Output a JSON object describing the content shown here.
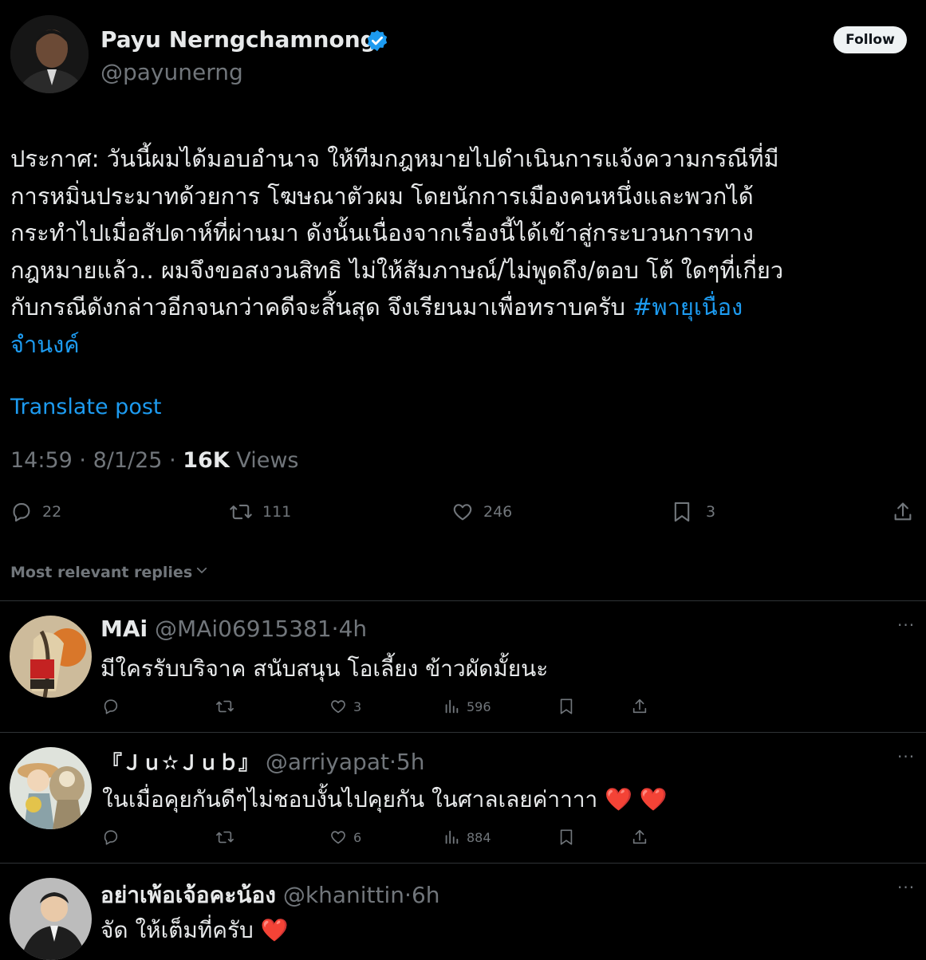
{
  "post": {
    "author_name": "Payu Nerngchamnong",
    "author_handle": "@payunerng",
    "follow_label": "Follow",
    "text_lines": [
      "ประกาศ: วันนี้ผมได้มอบอำนาจ ให้ทีมกฎหมายไปดำเนินการแจ้งความกรณีที่มี",
      "การหมิ่นประมาทด้วยการ โฆษณาตัวผม โดยนักการเมืองคนหนึ่งและพวกได้",
      "กระทำไปเมื่อสัปดาห์ที่ผ่านมา ดังนั้นเนื่องจากเรื่องนี้ได้เข้าสู่กระบวนการทาง",
      "กฎหมายแล้ว.. ผมจึงขอสงวนสิทธิ ไม่ให้สัมภาษณ์/ไม่พูดถึง/ตอบ โต้ ใดๆที่เกี่ยว",
      "กับกรณีดังกล่าวอีกจนกว่าคดีจะสิ้นสุด จึงเรียนมาเพื่อทราบครับ "
    ],
    "hashtag_part1": "#พายุเนื่อง",
    "hashtag_part2": "จำนงค์",
    "translate_label": "Translate post",
    "time": "14:59",
    "date": "8/1/25",
    "views_count": "16K",
    "views_label": "Views",
    "replies": "22",
    "reposts": "111",
    "likes": "246",
    "bookmarks": "3"
  },
  "replies_header": "Most relevant replies",
  "replies": [
    {
      "name": "MAi",
      "handle": "@MAi06915381",
      "time": "4h",
      "text": "มีใครรับบริจาค สนับสนุน โอเลี้ยง ข้าวผัดมั้ยนะ",
      "likes": "3",
      "views": "596"
    },
    {
      "name": "『Ｊｕ✫Ｊｕｂ』",
      "handle": "@arriyapat",
      "time": "5h",
      "text": "ในเมื่อคุยกันดีๆไม่ชอบงั้นไปคุยกัน ในศาลเลยค่าาาา ❤️ ❤️",
      "likes": "6",
      "views": "884"
    },
    {
      "name": "อย่าเพ้อเจ้อคะน้อง",
      "handle": "@khanittin",
      "time": "6h",
      "text": "จัด ให้เต็มที่ครับ ❤️"
    }
  ],
  "colors": {
    "background": "#000000",
    "text": "#e7e9ea",
    "muted": "#71767b",
    "accent": "#1d9bf0",
    "divider": "#2f3336"
  },
  "icons": [
    "verified-badge-icon",
    "reply-icon",
    "repost-icon",
    "like-icon",
    "bookmark-icon",
    "share-icon",
    "views-icon",
    "more-icon",
    "chevron-down-icon"
  ]
}
